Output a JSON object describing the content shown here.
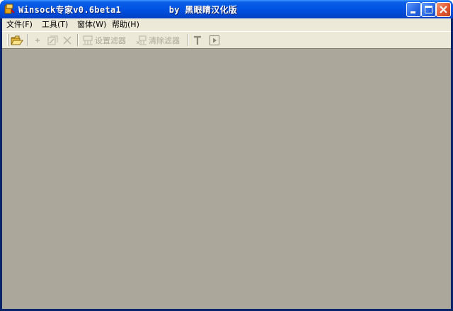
{
  "window": {
    "title": "Winsock专家v0.6beta1         by 黑眼睛汉化版",
    "controls": {
      "minimize": "minimize-icon",
      "maximize": "maximize-icon",
      "close": "close-icon"
    }
  },
  "menubar": {
    "items": [
      {
        "label": "文件(F)"
      },
      {
        "label": "工具(T)"
      },
      {
        "label": "窗体(W)"
      },
      {
        "label": "帮助(H)"
      }
    ]
  },
  "toolbar": {
    "open_icon": "folder-open-icon",
    "buttons": [
      {
        "icon": "add-icon"
      },
      {
        "icon": "edit-icon"
      },
      {
        "icon": "delete-icon"
      }
    ],
    "set_filter_label": "设置滤器",
    "clear_filter_label": "清除滤器",
    "extra": [
      {
        "icon": "text-icon"
      },
      {
        "icon": "play-icon"
      }
    ]
  },
  "colors": {
    "titlebar": "#0054e3",
    "frame": "#ece9d8",
    "client_area": "#aba89b",
    "close_button": "#e2562e",
    "disabled_text": "#aca899"
  }
}
